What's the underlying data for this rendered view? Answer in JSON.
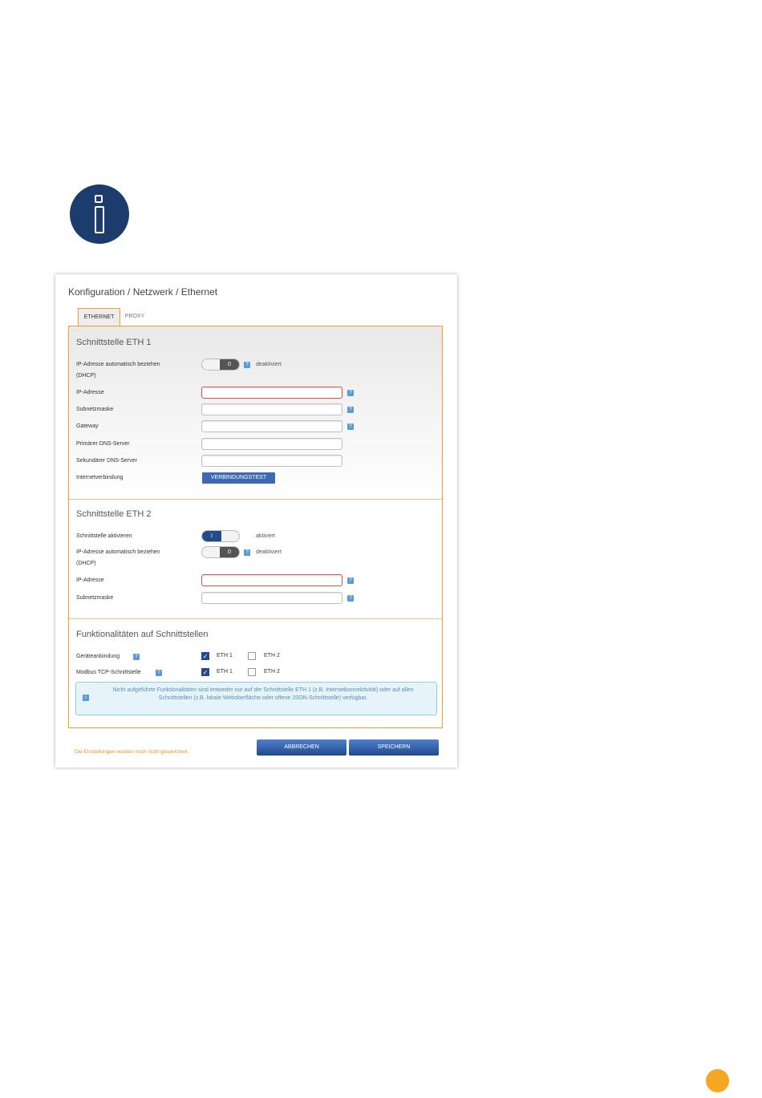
{
  "breadcrumb": "Konfiguration / Netzwerk / Ethernet",
  "tabs": [
    "ETHERNET",
    "PROXY"
  ],
  "eth1": {
    "title": "Schnittstelle ETH 1",
    "dhcp_label_1": "IP-Adresse automatisch beziehen",
    "dhcp_label_2": "(DHCP)",
    "dhcp_toggle": "0",
    "dhcp_state": "deaktiviert",
    "ip_label": "IP-Adresse",
    "subnet_label": "Subnetzmaske",
    "gateway_label": "Gateway",
    "dns1_label": "Primärer DNS-Server",
    "dns2_label": "Sekundärer DNS-Server",
    "internet_label": "Internetverbindung",
    "test_button": "VERBINDUNGSTEST"
  },
  "eth2": {
    "title": "Schnittstelle ETH 2",
    "activate_label": "Schnittstelle aktivieren",
    "activate_toggle": "I",
    "activate_state": "aktiviert",
    "dhcp_label_1": "IP-Adresse automatisch beziehen",
    "dhcp_label_2": "(DHCP)",
    "dhcp_toggle": "0",
    "dhcp_state": "deaktiviert",
    "ip_label": "IP-Adresse",
    "subnet_label": "Subnetzmaske"
  },
  "functions": {
    "title": "Funktionalitäten auf Schnittstellen",
    "rows": [
      {
        "label": "Geräteanbindung",
        "eth1": "ETH 1",
        "eth2": "ETH 2"
      },
      {
        "label": "Modbus TCP-Schnittstelle",
        "eth1": "ETH 1",
        "eth2": "ETH 2"
      }
    ],
    "checked_mark": "✓",
    "note": "Nicht aufgeführte Funktionalitäten sind entweder nur auf der Schnittstelle ETH 1 (z.B. Internetkonnektivität) oder auf allen Schnittstellen (z.B. lokale Weboberfläche oder offene JSON-Schnittstelle) verfügbar."
  },
  "help_symbol": "?",
  "info_symbol": "i",
  "unsaved_text": "Die Einstellungen wurden noch nicht gespeichert.",
  "cancel_button": "ABBRECHEN",
  "save_button": "SPEICHERN",
  "colors": {
    "accent_orange": "#f0a030",
    "primary_blue": "#234a8a",
    "info_blue": "#1d3c6e",
    "page_dot": "#f5a623"
  }
}
